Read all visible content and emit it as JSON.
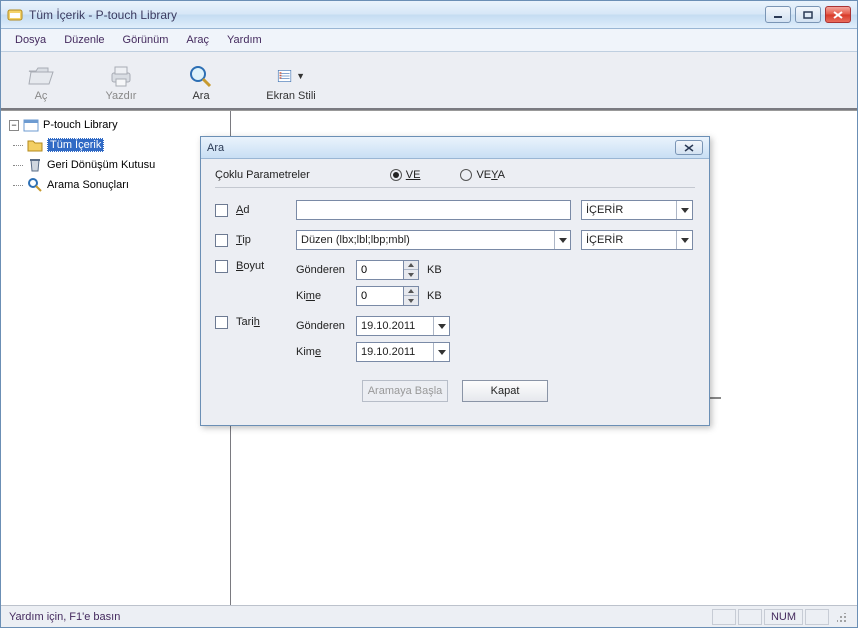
{
  "title": "Tüm İçerik - P-touch Library",
  "menu": {
    "file": "Dosya",
    "edit": "Düzenle",
    "view": "Görünüm",
    "tool": "Araç",
    "help": "Yardım"
  },
  "toolbar": {
    "open": "Aç",
    "print": "Yazdır",
    "search": "Ara",
    "style": "Ekran Stili"
  },
  "tree": {
    "root": "P-touch Library",
    "all": "Tüm İçerik",
    "recycle": "Geri Dönüşüm Kutusu",
    "results": "Arama Sonuçları"
  },
  "status": {
    "help": "Yardım için, F1'e basın",
    "num": "NUM"
  },
  "dialog": {
    "title": "Ara",
    "params": "Çoklu Parametreler",
    "and": "VE",
    "or": "VEYA",
    "name": "Ad",
    "type": "Tip",
    "type_value": "Düzen (lbx;lbl;lbp;mbl)",
    "size": "Boyut",
    "from": "Gönderen",
    "to": "Kime",
    "size_from": "0",
    "size_to": "0",
    "kb": "KB",
    "date": "Tarih",
    "date_from": "19.10.2011",
    "date_to": "19.10.2011",
    "contains": "İÇERİR",
    "start": "Aramaya Başla",
    "close": "Kapat"
  }
}
